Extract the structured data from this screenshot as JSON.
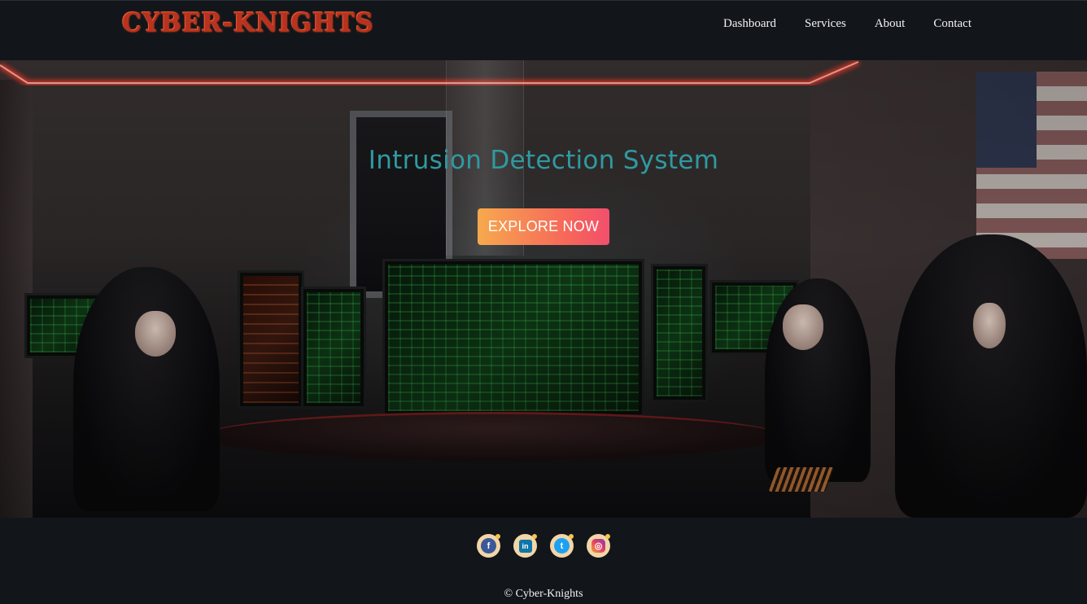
{
  "header": {
    "logo_text": "CYBER-KNIGHTS",
    "nav": [
      {
        "label": "Dashboard"
      },
      {
        "label": "Services"
      },
      {
        "label": "About"
      },
      {
        "label": "Contact"
      }
    ]
  },
  "hero": {
    "title": "Intrusion Detection System",
    "cta_label": "EXPLORE NOW",
    "background_image": "hackers-room-photo",
    "accent_colors": {
      "title": "#2f9aa0",
      "cta_start": "#f7a94e",
      "cta_end": "#f24f6c",
      "ceiling_glow": "#ff4a3a"
    }
  },
  "footer": {
    "socials": [
      {
        "icon": "facebook-icon",
        "glyph": "f",
        "color": "#3b5998"
      },
      {
        "icon": "linkedin-icon",
        "glyph": "in",
        "color": "#0e76a8"
      },
      {
        "icon": "twitter-icon",
        "glyph": "t",
        "color": "#1da1f2"
      },
      {
        "icon": "instagram-icon",
        "glyph": "◎",
        "color": "#c13584"
      }
    ],
    "copyright": "© Cyber-Knights"
  }
}
